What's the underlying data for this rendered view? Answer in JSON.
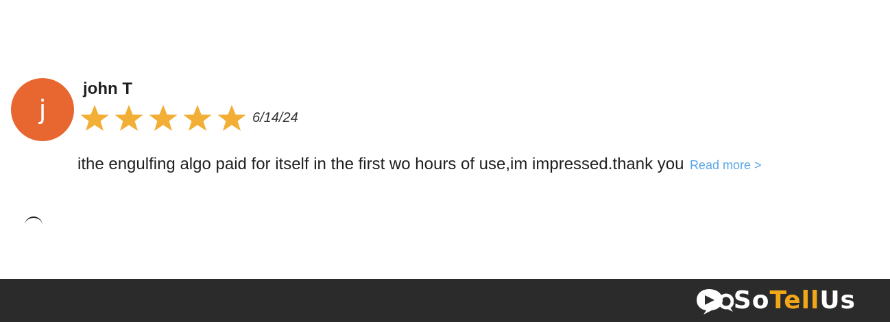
{
  "review": {
    "avatar_initial": "j",
    "author": "john T",
    "rating": 5,
    "rating_max": 5,
    "date": "6/14/24",
    "text": "ithe engulfing algo paid for itself in the first wo hours of use,im impressed.thank you",
    "read_more_label": "Read more >"
  },
  "footer": {
    "brand_so": "So",
    "brand_tell": "Tell",
    "brand_us": "Us"
  },
  "colors": {
    "avatar": "#e8662f",
    "star": "#f2ae35",
    "link": "#5aa5e6",
    "footer_bg": "#2b2b2b",
    "brand_accent": "#f2a71b"
  },
  "icons": {
    "star": "star-icon",
    "brand": "chat-bubble-icon"
  }
}
